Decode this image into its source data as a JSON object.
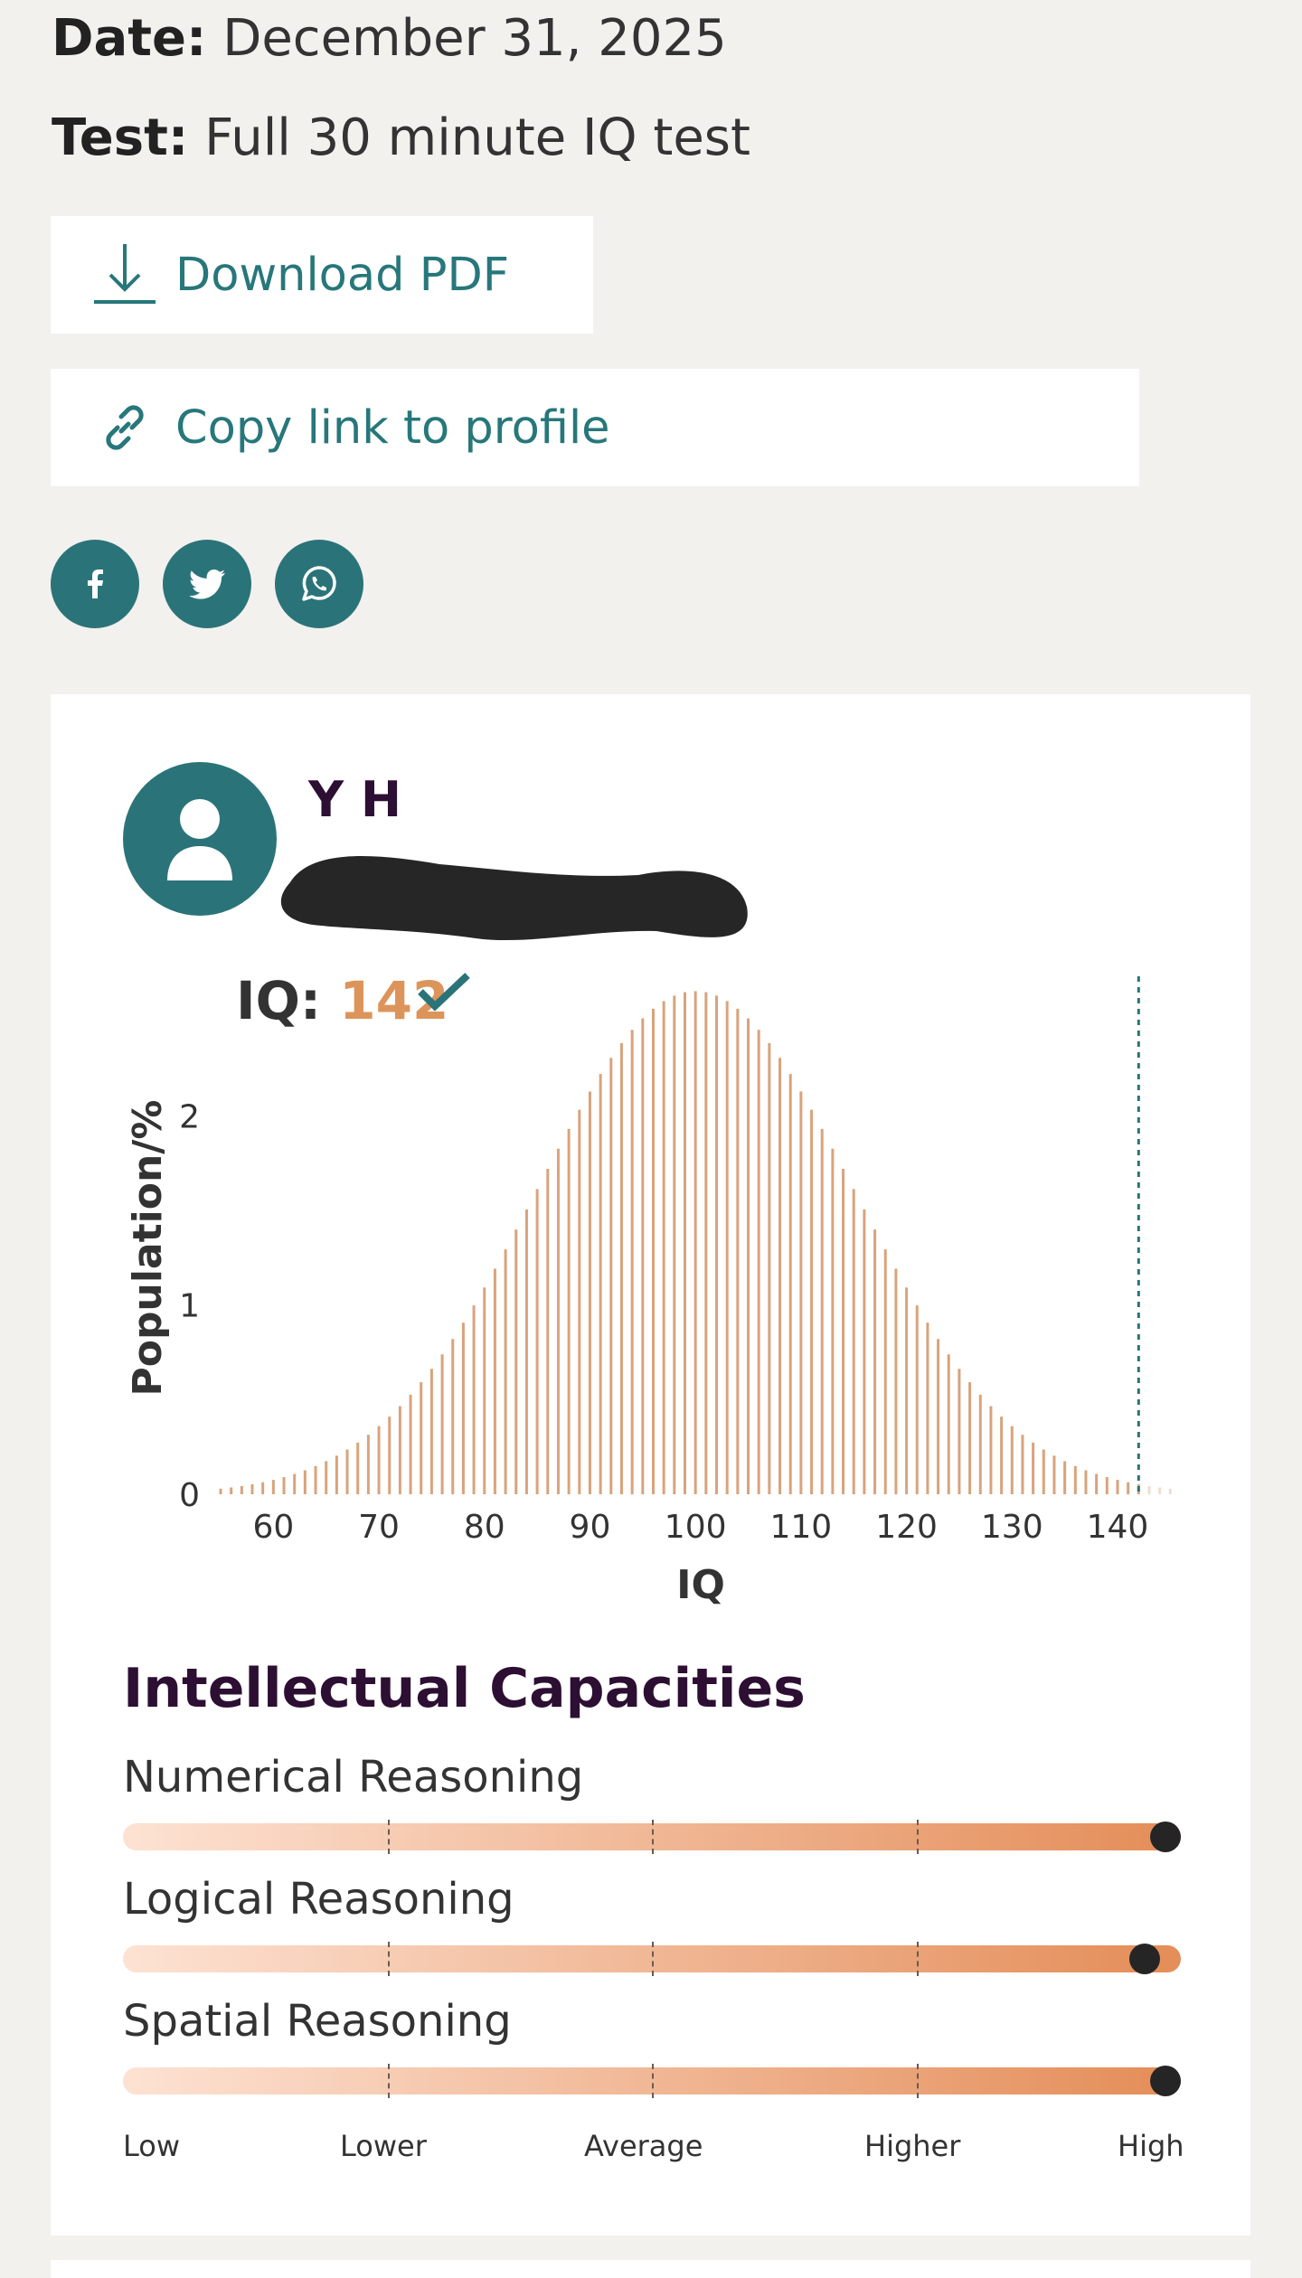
{
  "meta": {
    "date_label": "Date:",
    "date_value": "December 31, 2025",
    "test_label": "Test:",
    "test_value": "Full 30 minute IQ test"
  },
  "actions": {
    "download_label": "Download PDF",
    "copy_label": "Copy link to profile"
  },
  "social": {
    "icons": [
      "facebook-icon",
      "twitter-icon",
      "whatsapp-icon"
    ]
  },
  "result": {
    "user_name": "Y H",
    "iq_label": "IQ:",
    "iq_value": "142",
    "accent_color": "#dd945a",
    "brand_color": "#2a7479"
  },
  "chart_data": {
    "type": "bar",
    "xlabel": "IQ",
    "ylabel": "Population/%",
    "xlim": [
      55,
      146
    ],
    "ylim": [
      0,
      2.7
    ],
    "xticks": [
      "60",
      "70",
      "80",
      "90",
      "100",
      "110",
      "120",
      "130",
      "140"
    ],
    "yticks": [
      "0",
      "1",
      "2"
    ],
    "distribution": {
      "mean": 100,
      "sd": 15,
      "x_start": 55,
      "x_end": 145,
      "step": 1
    },
    "marker_x": 142,
    "grid": false
  },
  "capacities": {
    "title": "Intellectual Capacities",
    "items": [
      {
        "label": "Numerical Reasoning",
        "level": 1.0
      },
      {
        "label": "Logical Reasoning",
        "level": 0.98
      },
      {
        "label": "Spatial Reasoning",
        "level": 1.0
      }
    ],
    "scale": [
      "Low",
      "Lower",
      "Average",
      "Higher",
      "High"
    ]
  }
}
